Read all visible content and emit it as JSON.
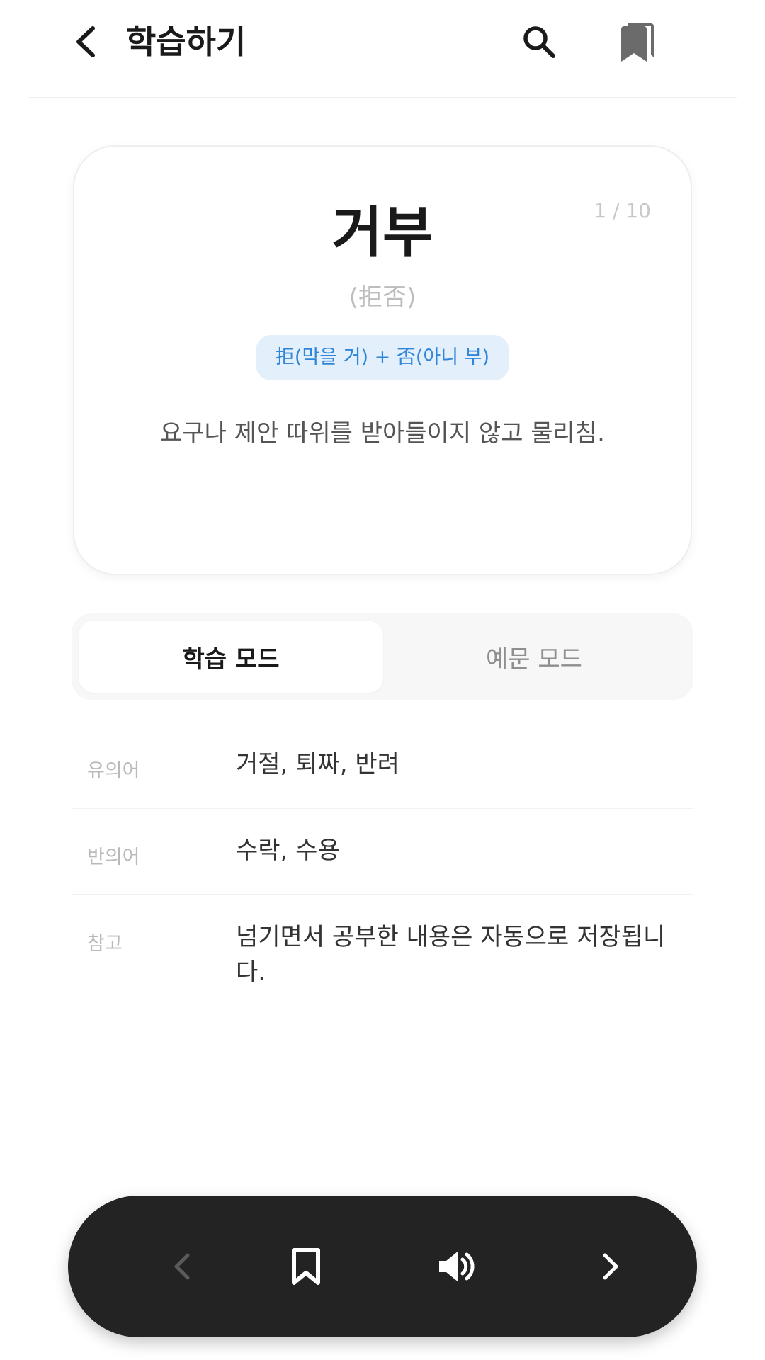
{
  "header": {
    "title": "학습하기",
    "back_icon": "chevron-left-icon",
    "search_icon": "search-icon",
    "bookmarks_icon": "bookmarks-icon"
  },
  "card": {
    "counter": "1 / 10",
    "word": "거부",
    "hanja": "(拒否)",
    "etymology": "拒(막을 거) + 否(아니 부)",
    "definition": "요구나 제안 따위를 받아들이지 않고 물리침."
  },
  "modes": {
    "study": "학습 모드",
    "example": "예문 모드",
    "selected": "학습 모드"
  },
  "info": [
    {
      "label": "유의어",
      "value": "거절, 퇴짜, 반려"
    },
    {
      "label": "반의어",
      "value": "수락, 수용"
    },
    {
      "label": "참고",
      "value": "넘기면서 공부한 내용은 자동으로 저장됩니다."
    }
  ],
  "bottom_bar": {
    "prev_icon": "chevron-left-icon",
    "bookmark_icon": "bookmark-icon",
    "sound_icon": "speaker-icon",
    "next_icon": "chevron-right-icon"
  },
  "colors": {
    "accent": "#2f86d8",
    "accent_bg": "#e3f0fc",
    "bar_bg": "#232323"
  }
}
